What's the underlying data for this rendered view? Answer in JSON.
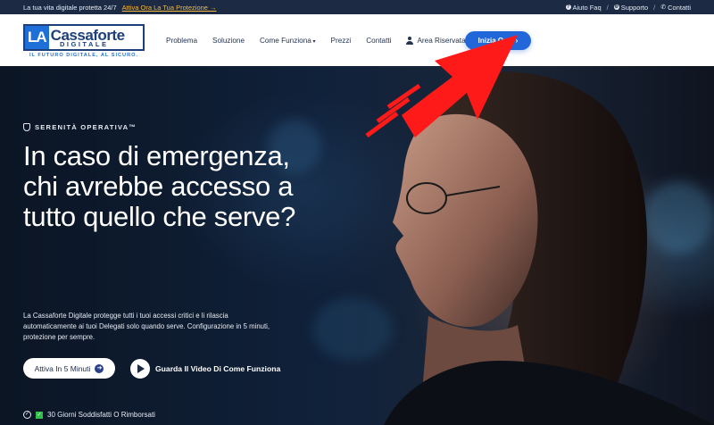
{
  "topbar": {
    "tagline": "La tua vita digitale protetta 24/7",
    "promo_link": "Attiva Ora La Tua Protezione →",
    "links": [
      {
        "icon": "question-circle-icon",
        "label": "Aiuto Faq"
      },
      {
        "icon": "support-gear-icon",
        "label": "Supporto"
      },
      {
        "icon": "phone-icon",
        "label": "Contatti"
      }
    ],
    "separator": "/"
  },
  "logo": {
    "la": "LA",
    "main": "Cassaforte",
    "sub": "DIGITALE",
    "tagline": "IL FUTURO DIGITALE, AL SICURO."
  },
  "nav": {
    "items": [
      "Problema",
      "Soluzione",
      "Come Funziona",
      "Prezzi",
      "Contatti"
    ],
    "area": "Area Riservata",
    "cta": "Inizia Ora",
    "cta_arrow": "›"
  },
  "hero": {
    "eyebrow": "SERENITÀ OPERATIVA™",
    "headline": "In caso di emergenza, chi avrebbe accesso a tutto quello che serve?",
    "description": "La Cassaforte Digitale protegge tutti i tuoi accessi critici e li rilascia automaticamente ai tuoi Delegati solo quando serve. Configurazione in 5 minuti, protezione per sempre.",
    "primary_button": "Attiva In 5 Minuti",
    "video_button": "Guarda Il Video Di Come Funziona",
    "guarantee": "30 Giorni Soddisfatti O Rimborsati",
    "guarantee_check": "✓"
  },
  "colors": {
    "primary_blue": "#2167d9",
    "topbar_bg": "#1c2a44",
    "promo_gold": "#f5b93b",
    "overlay_arrow": "#ff1a1a"
  }
}
